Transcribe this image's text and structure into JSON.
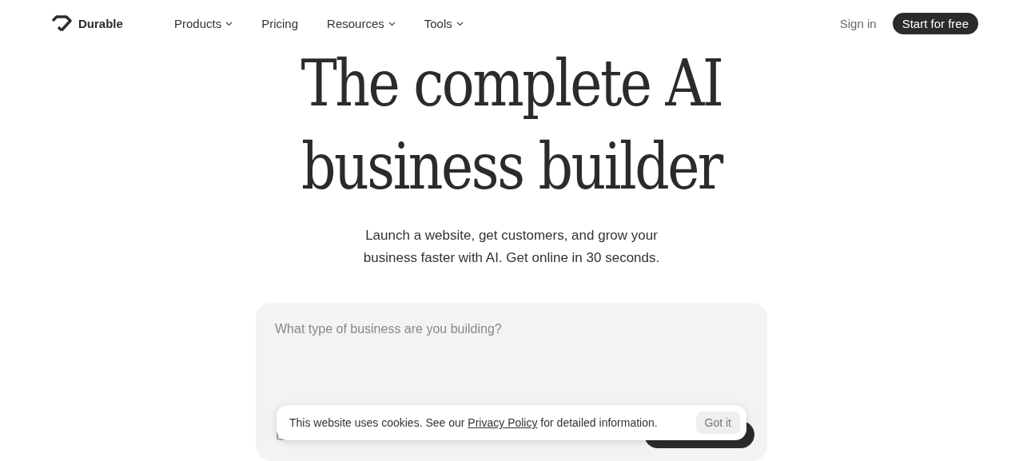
{
  "brand": {
    "name": "Durable"
  },
  "nav": [
    {
      "label": "Products",
      "dropdown": true
    },
    {
      "label": "Pricing",
      "dropdown": false
    },
    {
      "label": "Resources",
      "dropdown": true
    },
    {
      "label": "Tools",
      "dropdown": true
    }
  ],
  "sign_in": "Sign in",
  "cta": "Start for free",
  "hero": {
    "title_lines": [
      "The complete AI",
      "business builder"
    ],
    "subtitle_lines": [
      "Launch a website, get customers, and grow your",
      "business faster with AI. Get online in 30 seconds."
    ]
  },
  "prompt": {
    "placeholder": "What type of business are you building?"
  },
  "cookie": {
    "before": "This website uses cookies. See our ",
    "link": "Privacy Policy",
    "after": " for detailed information.",
    "button": "Got it"
  }
}
